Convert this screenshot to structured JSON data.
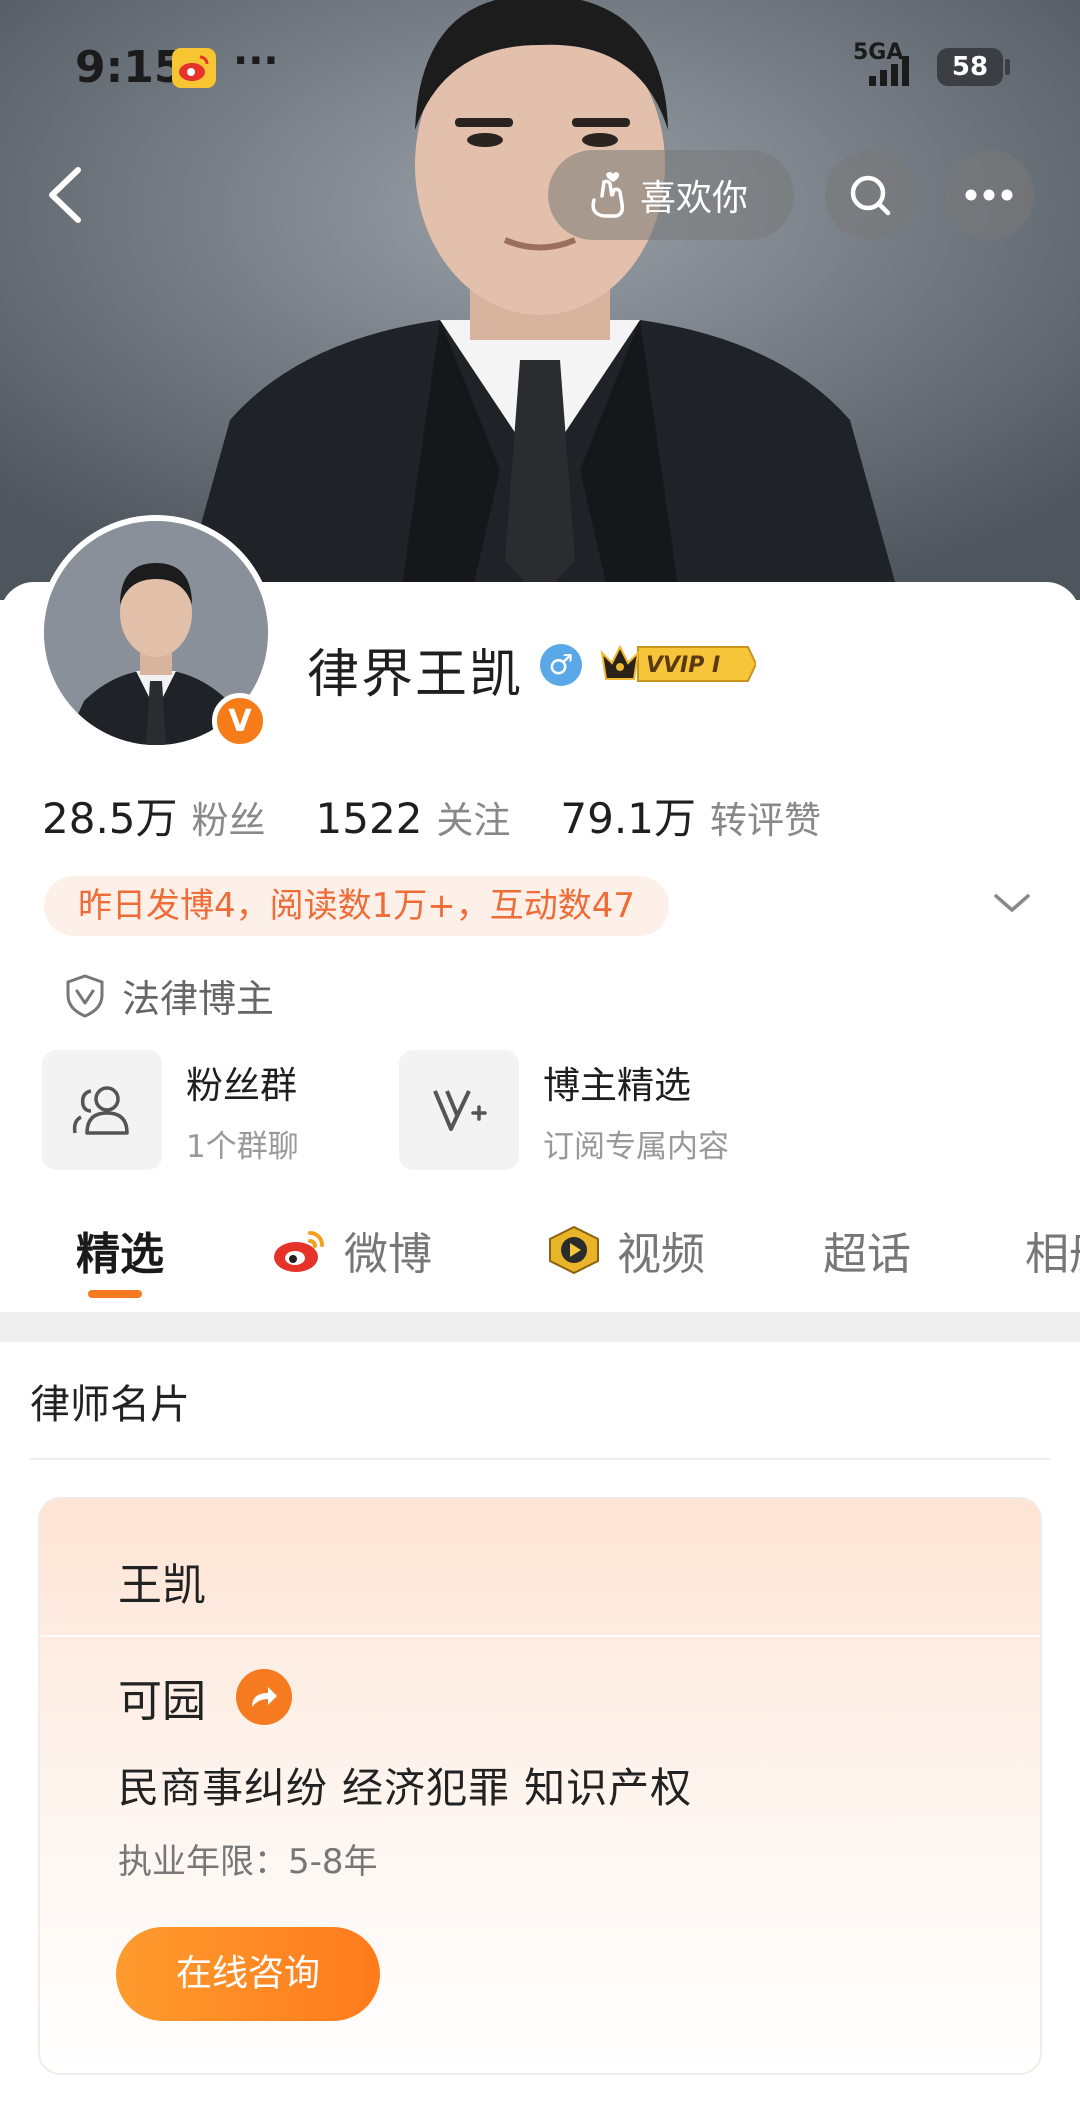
{
  "status_bar": {
    "time": "9:15",
    "network": "5GA",
    "battery": "58"
  },
  "header": {
    "like_label": "喜欢你"
  },
  "profile": {
    "name": "律界王凯",
    "gender": "♂",
    "vip_badge": "VVIP I",
    "verified_mark": "V",
    "stats": [
      {
        "value": "28.5万",
        "label": "粉丝"
      },
      {
        "value": "1522",
        "label": "关注"
      },
      {
        "value": "79.1万",
        "label": "转评赞"
      }
    ],
    "activity": "昨日发博4，阅读数1万+，互动数47",
    "tag": "法律博主"
  },
  "entries": [
    {
      "title": "粉丝群",
      "subtitle": "1个群聊",
      "icon": "people-icon"
    },
    {
      "title": "博主精选",
      "subtitle": "订阅专属内容",
      "icon": "v-plus-icon"
    }
  ],
  "tabs": [
    {
      "label": "精选",
      "active": true
    },
    {
      "label": "微博",
      "icon": "weibo-icon"
    },
    {
      "label": "视频",
      "icon": "video-icon"
    },
    {
      "label": "超话"
    },
    {
      "label": "相册"
    }
  ],
  "lawyer_card": {
    "section_title": "律师名片",
    "name": "王凯",
    "firm": "可园",
    "practice_areas": "民商事纠纷 经济犯罪 知识产权",
    "years": "执业年限：5-8年",
    "consult_label": "在线咨询"
  },
  "colors": {
    "accent": "#f57a20",
    "activity_text": "#ee6c38",
    "activity_bg": "#fdf0e9"
  }
}
